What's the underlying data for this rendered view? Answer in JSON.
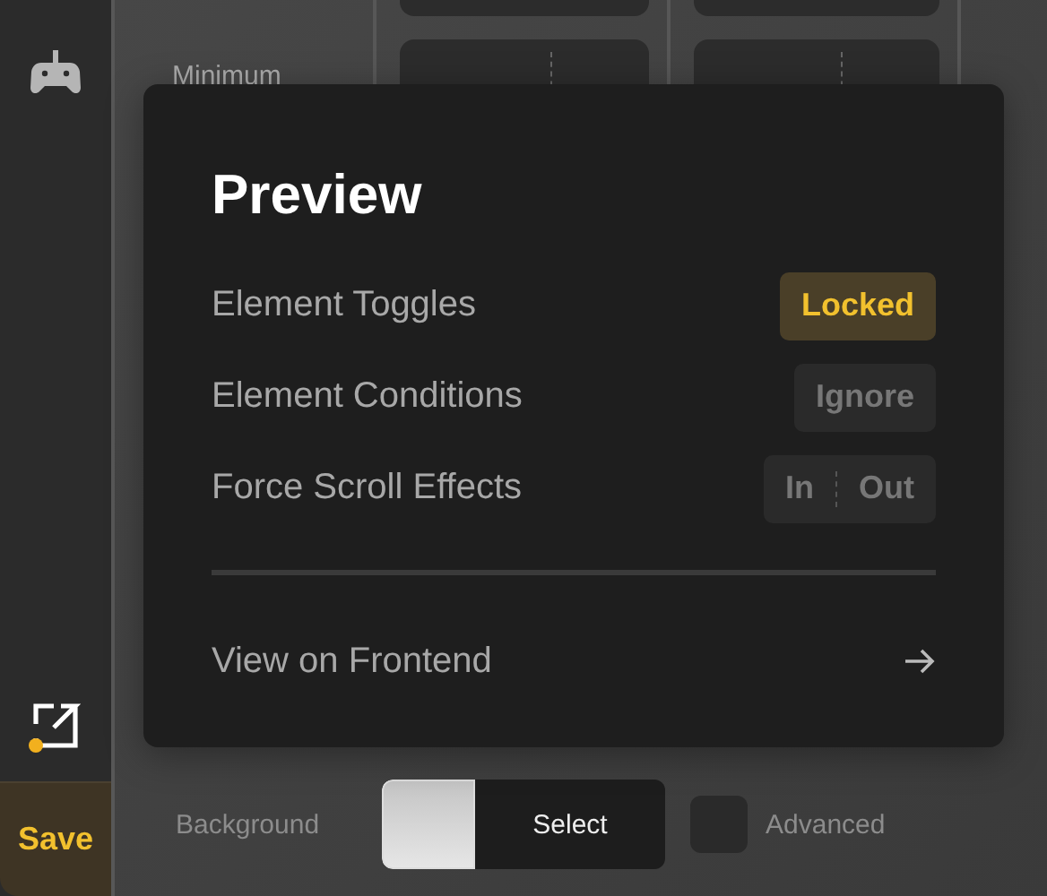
{
  "sidebar": {
    "save_label": "Save"
  },
  "dimensions": {
    "label": "Minimum"
  },
  "preview": {
    "title": "Preview",
    "rows": [
      {
        "label": "Element Toggles",
        "kind": "single",
        "options": [
          {
            "label": "Locked",
            "selected": true
          }
        ]
      },
      {
        "label": "Element Conditions",
        "kind": "single",
        "options": [
          {
            "label": "Ignore",
            "selected": false
          }
        ]
      },
      {
        "label": "Force Scroll Effects",
        "kind": "segmented",
        "options": [
          {
            "label": "In",
            "selected": false
          },
          {
            "label": "Out",
            "selected": false
          }
        ]
      }
    ],
    "link": {
      "label": "View on Frontend"
    }
  },
  "background": {
    "label": "Background",
    "button": "Select",
    "advanced": {
      "label": "Advanced",
      "checked": false
    }
  }
}
